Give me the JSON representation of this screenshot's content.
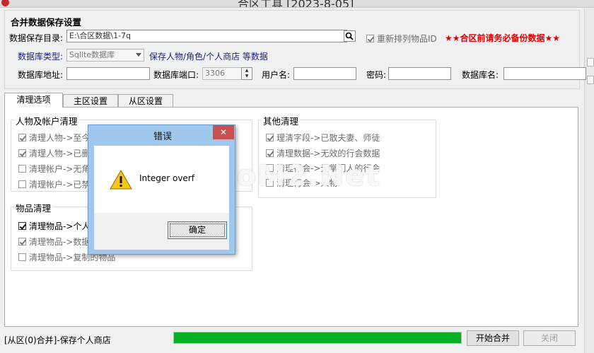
{
  "window": {
    "title": "合区工具 [2023-8-05]"
  },
  "settings": {
    "heading": "合并数据保存设置",
    "save_dir_label": "数据保存目录:",
    "save_dir_value": "E:\\合区数据\\1-7q",
    "reorder_label": "重新排列物品ID",
    "warning_text": "★★合区前请务必备份数据★★",
    "db_type_label": "数据库类型:",
    "db_type_value": "Sqlite数据库",
    "db_type_hint": "保存人物/角色/个人商店 等数据",
    "db_addr_label": "数据库地址:",
    "db_addr_value": "",
    "db_port_label": "数据库端口:",
    "db_port_value": "3306",
    "user_label": "用户名:",
    "user_value": "",
    "password_label": "密码:",
    "password_value": "",
    "db_name_label": "数据库名:",
    "db_name_value": ""
  },
  "tabs": [
    {
      "label": "清理选项",
      "active": true
    },
    {
      "label": "主区设置",
      "active": false
    },
    {
      "label": "从区设置",
      "active": false
    }
  ],
  "groups": {
    "account": {
      "title": "人物及帐户清理",
      "items": [
        {
          "label": "清理人物->至今",
          "checked": true
        },
        {
          "label": "清理人物->已删",
          "checked": true
        },
        {
          "label": "清理帐户->无角",
          "checked": false
        },
        {
          "label": "清理帐户->已禁",
          "checked": false
        }
      ]
    },
    "goods": {
      "title": "物品清理",
      "items": [
        {
          "label": "清理物品->个人",
          "checked": true
        },
        {
          "label": "清理物品->数据",
          "checked": true
        },
        {
          "label": "清理物品->复制的物品",
          "checked": false
        }
      ]
    },
    "other": {
      "title": "其他清理",
      "items": [
        {
          "label": "理清字段->已散夫妻、师徒",
          "checked": true
        },
        {
          "label": "清理数据->无效的行会数据",
          "checked": true
        },
        {
          "label": "清理行会->无掌门人的行会",
          "checked": false
        },
        {
          "label": "清理行会->人物",
          "checked": false
        }
      ]
    }
  },
  "dialog": {
    "title": "错误",
    "close_glyph": "✕",
    "message": "Integer overf",
    "ok_label": "确定"
  },
  "footer": {
    "status_text": "[从区(0)合并]-保存个人商店",
    "progress": 1.0,
    "start_label": "开始合并",
    "close_label": "关闭"
  },
  "watermark": "HaoM2.Net",
  "colors": {
    "accent": "#06b025",
    "warning": "#e00000",
    "dialog_frame": "#9fc8ec",
    "close_button": "#c75050"
  }
}
